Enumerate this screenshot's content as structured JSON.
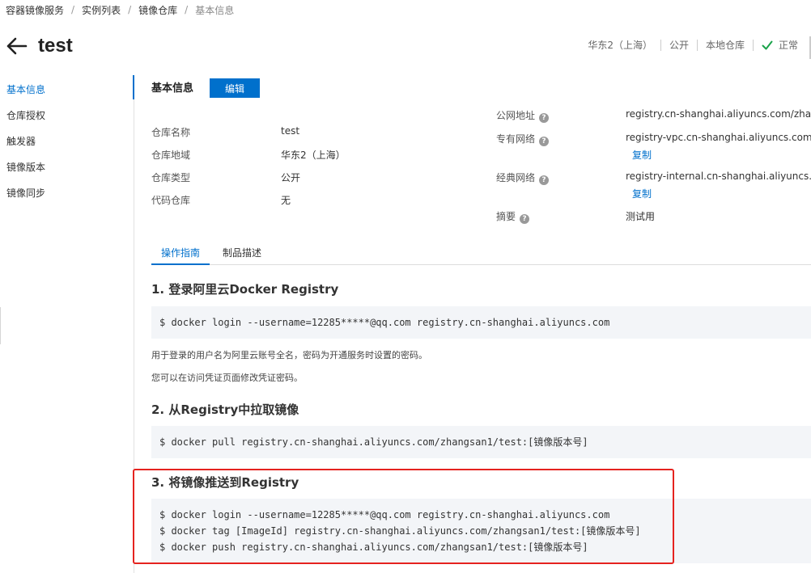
{
  "breadcrumb": {
    "items": [
      "容器镜像服务",
      "实例列表",
      "镜像仓库"
    ],
    "current": "基本信息"
  },
  "header": {
    "title": "test",
    "region": "华东2（上海）",
    "visibility": "公开",
    "repo_type": "本地仓库",
    "status": "正常",
    "status_color": "#1aa34a"
  },
  "sidebar": {
    "items": [
      {
        "label": "基本信息",
        "active": true
      },
      {
        "label": "仓库授权"
      },
      {
        "label": "触发器"
      },
      {
        "label": "镜像版本"
      },
      {
        "label": "镜像同步"
      }
    ]
  },
  "basic_info": {
    "section_title": "基本信息",
    "edit_label": "编辑",
    "fields": [
      {
        "label": "仓库名称",
        "value": "test"
      },
      {
        "label": "仓库地域",
        "value": "华东2（上海）"
      },
      {
        "label": "仓库类型",
        "value": "公开"
      },
      {
        "label": "代码仓库",
        "value": "无"
      }
    ],
    "endpoints": [
      {
        "label": "公网地址",
        "value": "registry.cn-shanghai.aliyuncs.com/zhangsan"
      },
      {
        "label": "专有网络",
        "value": "registry-vpc.cn-shanghai.aliyuncs.com/zhan",
        "copy": "复制"
      },
      {
        "label": "经典网络",
        "value": "registry-internal.cn-shanghai.aliyuncs.com/z",
        "copy": "复制"
      },
      {
        "label": "摘要",
        "value": "测试用"
      }
    ]
  },
  "tabs": [
    {
      "label": "操作指南",
      "active": true
    },
    {
      "label": "制品描述"
    }
  ],
  "guide": {
    "steps": [
      {
        "title": "1. 登录阿里云Docker Registry",
        "code": [
          "$ docker login --username=12285*****@qq.com registry.cn-shanghai.aliyuncs.com"
        ],
        "notes": [
          "用于登录的用户名为阿里云账号全名，密码为开通服务时设置的密码。",
          "您可以在访问凭证页面修改凭证密码。"
        ]
      },
      {
        "title": "2. 从Registry中拉取镜像",
        "code": [
          "$ docker pull registry.cn-shanghai.aliyuncs.com/zhangsan1/test:[镜像版本号]"
        ]
      },
      {
        "title": "3. 将镜像推送到Registry",
        "code": [
          "$ docker login --username=12285*****@qq.com registry.cn-shanghai.aliyuncs.com",
          "$ docker tag [ImageId] registry.cn-shanghai.aliyuncs.com/zhangsan1/test:[镜像版本号]",
          "$ docker push registry.cn-shanghai.aliyuncs.com/zhangsan1/test:[镜像版本号]"
        ]
      }
    ]
  },
  "colors": {
    "accent": "#0070cc",
    "highlight": "#e5231f",
    "code_bg": "#f3f5f8"
  }
}
